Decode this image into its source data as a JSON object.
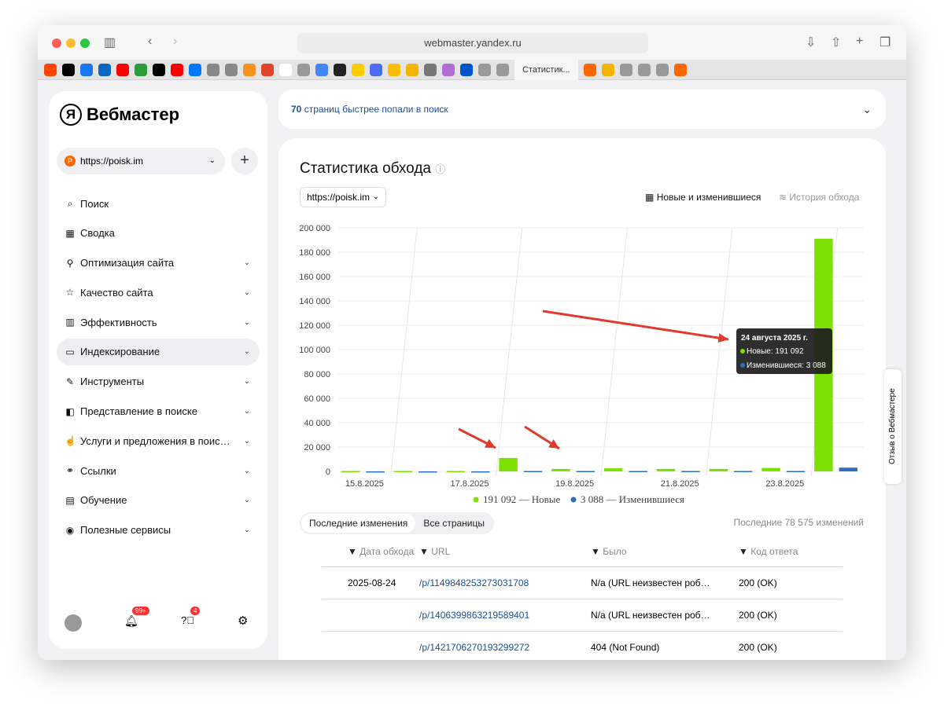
{
  "browser": {
    "url": "webmaster.yandex.ru",
    "active_tab": "Статистик...",
    "favicons": [
      "reddit",
      "threads",
      "facebook",
      "linkedin",
      "youtube",
      "plus",
      "x",
      "youtube",
      "vk",
      "perplexity",
      "safari",
      "ok",
      "gitlab",
      "x",
      "dots",
      "gemini",
      "dark",
      "smile",
      "c",
      "one",
      "analytics",
      "vcru",
      "podcasts",
      "circle",
      "G",
      "G"
    ],
    "favicons_after": [
      "P",
      "analytics",
      "G",
      "I",
      "B",
      "P"
    ]
  },
  "app": {
    "logo": "Вебмастер",
    "site": "https://poisk.im",
    "add": "+"
  },
  "nav": [
    {
      "label": "Поиск",
      "icon": "⌕",
      "chev": false
    },
    {
      "label": "Сводка",
      "icon": "▦",
      "chev": false
    },
    {
      "label": "Оптимизация сайта",
      "icon": "⚲",
      "chev": true
    },
    {
      "label": "Качество сайта",
      "icon": "☆",
      "chev": true
    },
    {
      "label": "Эффективность",
      "icon": "▥",
      "chev": true
    },
    {
      "label": "Индексирование",
      "icon": "▭",
      "chev": true,
      "active": true
    },
    {
      "label": "Инструменты",
      "icon": "✎",
      "chev": true
    },
    {
      "label": "Представление в поиске",
      "icon": "◧",
      "chev": true
    },
    {
      "label": "Услуги и предложения в поис…",
      "icon": "☝",
      "chev": true
    },
    {
      "label": "Ссылки",
      "icon": "⚭",
      "chev": true
    },
    {
      "label": "Обучение",
      "icon": "▤",
      "chev": true
    },
    {
      "label": "Полезные сервисы",
      "icon": "◉",
      "chev": true
    }
  ],
  "footer": {
    "notifications": "99+",
    "help": "4"
  },
  "banner": {
    "count": "70",
    "text": "страниц быстрее попали в поиск"
  },
  "main": {
    "title": "Статистика обхода",
    "site_select": "https://poisk.im",
    "view_new": "Новые и изменившиеся",
    "view_history": "История обхода",
    "tabs": [
      "Последние изменения",
      "Все страницы"
    ],
    "summary": "Последние 78 575 изменений",
    "feedback": "Отзыв о Вебмастере"
  },
  "table": {
    "headers": [
      "Дата обхода",
      "URL",
      "Было",
      "Код ответа"
    ],
    "rows": [
      {
        "date": "2025-08-24",
        "url": "/p/1149848253273031708",
        "was": "N/a (URL неизвестен роб…",
        "code": "200 (OK)"
      },
      {
        "date": "",
        "url": "/p/1406399863219589401",
        "was": "N/a (URL неизвестен роб…",
        "code": "200 (OK)"
      },
      {
        "date": "",
        "url": "/p/1421706270193299272",
        "was": "404 (Not Found)",
        "code": "200 (OK)"
      }
    ]
  },
  "chart_data": {
    "type": "bar",
    "categories": [
      "15.8.2025",
      "16.8.2025",
      "17.8.2025",
      "18.8.2025",
      "19.8.2025",
      "20.8.2025",
      "21.8.2025",
      "22.8.2025",
      "23.8.2025",
      "24.8.2025"
    ],
    "x_tick_labels": [
      "15.8.2025",
      "17.8.2025",
      "19.8.2025",
      "21.8.2025",
      "23.8.2025"
    ],
    "series": [
      {
        "name": "Новые",
        "color": "#7ee000",
        "values": [
          300,
          300,
          300,
          11000,
          2000,
          2500,
          2000,
          2000,
          2800,
          191092
        ]
      },
      {
        "name": "Изменившиеся",
        "color": "#2c6fc1",
        "values": [
          0,
          0,
          0,
          300,
          300,
          300,
          300,
          300,
          300,
          3088
        ]
      }
    ],
    "ylim": [
      0,
      200000
    ],
    "yticks": [
      "0",
      "20 000",
      "40 000",
      "60 000",
      "80 000",
      "100 000",
      "120 000",
      "140 000",
      "160 000",
      "180 000",
      "200 000"
    ],
    "legend": [
      "191 092 — Новые",
      "3 088 — Изменившиеся"
    ],
    "tooltip": {
      "title": "24 августа 2025 г.",
      "new": "Новые: 191 092",
      "changed": "Изменившиеся: 3 088"
    }
  }
}
